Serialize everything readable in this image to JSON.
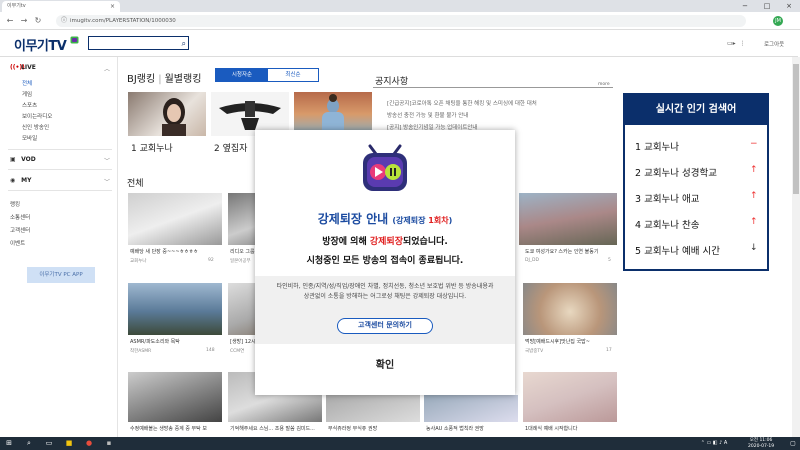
{
  "browser": {
    "tab_title": "이무기tv",
    "tab_close": "×",
    "url": "imugitv.com/PLAYERSTATION/1000030",
    "profile_initial": "JM",
    "window_controls": [
      "−",
      "□",
      "×"
    ]
  },
  "header": {
    "logo_text": "이무기",
    "logo_tv": "TV",
    "login_label": "로그아웃"
  },
  "sidebar": {
    "live_label": "LIVE",
    "live_items": [
      "전체",
      "게임",
      "스포츠",
      "보이는라디오",
      "신인 방송인",
      "모바일"
    ],
    "vod_label": "VOD",
    "my_label": "MY",
    "links": [
      "랭킹",
      "소통센터",
      "고객센터",
      "이벤트"
    ],
    "pc_app_label": "이무기TV PC APP"
  },
  "main": {
    "bj_rank": "BJ랭킹",
    "monthly_rank": "월별랭킹",
    "sort_views": "시청자순",
    "sort_latest": "최신순",
    "rank_labels": [
      "1  교회누나",
      "2  옆집자"
    ],
    "notice_title": "공지사항",
    "notice_more": "more",
    "notice_items": [
      "[긴급공지]코로아톡 오픈 채팅을 통한 해킹 및 스미싱에 대한 대처",
      "방송선 충전 가능 및 환불 불가 안내",
      "[공지] 방송인기념일 가능 업데이트안내"
    ],
    "section_all": "전체",
    "tiles": [
      {
        "caption": "예배당 새 단장 중~~~ㅎㅎㅎㅎ",
        "channel": "교회누나",
        "count": "92"
      },
      {
        "caption": "리디오 그룹",
        "channel": "일본어공부",
        "count": ""
      },
      {
        "caption": "",
        "channel": "",
        "count": ""
      },
      {
        "caption": "도쿄 여성가요? 스카는 인연 불동기",
        "channel": "DJ_DD",
        "count": "5"
      },
      {
        "caption": "ASMR/파도소리와 목탁",
        "channel": "착한ASMR",
        "count": "148"
      },
      {
        "caption": "[생방] 12시",
        "channel": "CCM연",
        "count": ""
      },
      {
        "caption": "",
        "channel": "",
        "count": ""
      },
      {
        "caption": "먹방[예배드시후]맛난집 국밥~",
        "channel": "국밥중TV",
        "count": "17"
      },
      {
        "caption": "수정예배볼는 생방송 중계 중 부탁 보",
        "channel": "",
        "count": ""
      },
      {
        "caption": "기억해주세요 스님... 조용 말씀 김미드...",
        "channel": "",
        "count": ""
      },
      {
        "caption": "무식쥬라정 무식쥬 권망",
        "channel": "",
        "count": ""
      },
      {
        "caption": "농사AU 소풍적 법칙라 권망",
        "channel": "",
        "count": ""
      },
      {
        "caption": "1대례식 예배 시작합니다",
        "channel": "",
        "count": ""
      }
    ]
  },
  "hot_keywords": {
    "title": "실시간 인기 검색어",
    "items": [
      {
        "rank": "1",
        "text": "교회누나",
        "trend": "−"
      },
      {
        "rank": "2",
        "text": "교회누나 성경학교",
        "trend": "↑"
      },
      {
        "rank": "3",
        "text": "교회누나 애교",
        "trend": "↑"
      },
      {
        "rank": "4",
        "text": "교회누나 찬송",
        "trend": "↑"
      },
      {
        "rank": "5",
        "text": "교회누나 예배 시간",
        "trend": "↓"
      }
    ]
  },
  "modal": {
    "title_main": "강제퇴장 안내",
    "title_paren_open": "(강제퇴장 ",
    "title_count": "1회차",
    "title_paren_close": ")",
    "line1_pre": "방장에 의해 ",
    "line1_red": "강제퇴장",
    "line1_post": "되었습니다.",
    "line2": "시청중인 모든 방송의 접속이 종료됩니다.",
    "description": "타인비하, 인종/지역/성/직업/장애인 차별, 정치선동, 청소년 보호법 위반 등 방송내용과 상관없이 소통을 방해하는 어그로성 채팅은 강제퇴장 대상입니다.",
    "help_button": "고객센터 문의하기",
    "ok_button": "확인"
  },
  "taskbar": {
    "time": "오전 11:06",
    "date": "2020-07-19"
  },
  "colors": {
    "brand_navy": "#0b2f6b",
    "accent_blue": "#1a5bbf",
    "alert_red": "#e02020"
  }
}
